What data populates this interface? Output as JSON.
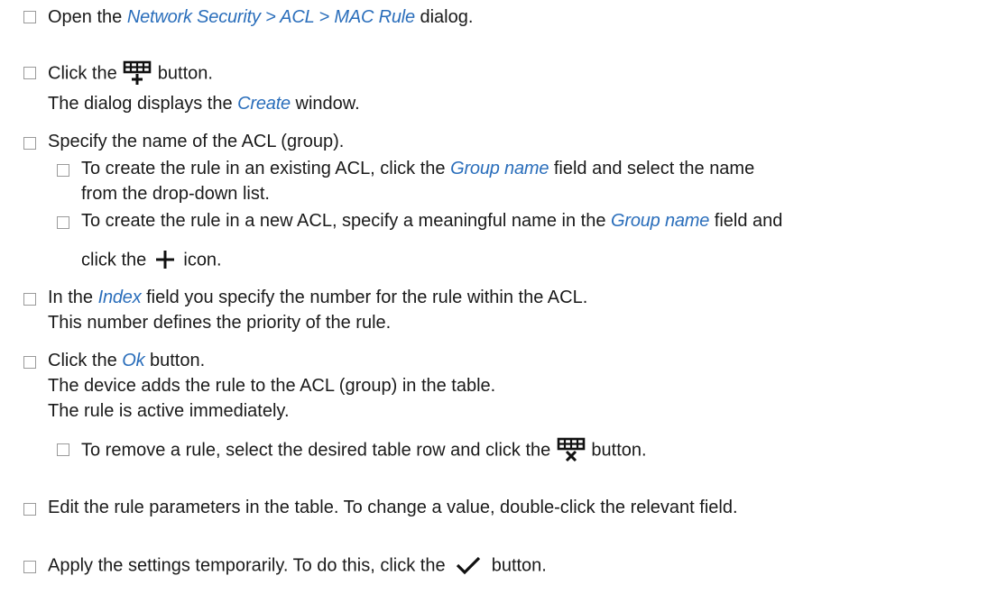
{
  "steps": [
    {
      "pre": "Open the ",
      "ref": "Network Security > ACL > MAC Rule",
      "post": " dialog."
    },
    {
      "pre": "Click the ",
      "post": " button.",
      "icon": "table-add-icon",
      "sub_pre": "The dialog displays the ",
      "sub_ref": "Create",
      "sub_post": " window."
    },
    {
      "text": "Specify the name of the ACL (group).",
      "sub1": {
        "pre": "To create the rule in an existing ACL, click the ",
        "ref": "Group name",
        "post": " field and select the name",
        "line2": "from the drop-down list."
      },
      "sub2": {
        "pre": "To create the rule in a new ACL, specify a meaningful name in the ",
        "ref": "Group name",
        "post": " field and",
        "line2_pre": "click the ",
        "line2_post": " icon.",
        "icon": "plus-icon"
      }
    },
    {
      "pre": "In the ",
      "ref": "Index",
      "post": " field you specify the number for the rule within the ACL.",
      "line2": "This number defines the priority of the rule."
    },
    {
      "pre": "Click the ",
      "ref": "Ok",
      "post": " button.",
      "line2": "The device adds the rule to the ACL (group) in the table.",
      "line3": "The rule is active immediately.",
      "sub": {
        "pre": "To remove a rule, select the desired table row and click the ",
        "post": " button.",
        "icon": "table-remove-icon"
      }
    },
    {
      "text": "Edit the rule parameters in the table. To change a value, double-click the relevant field."
    },
    {
      "pre": "Apply the settings temporarily. To do this, click the ",
      "post": " button.",
      "icon": "checkmark-icon"
    }
  ]
}
